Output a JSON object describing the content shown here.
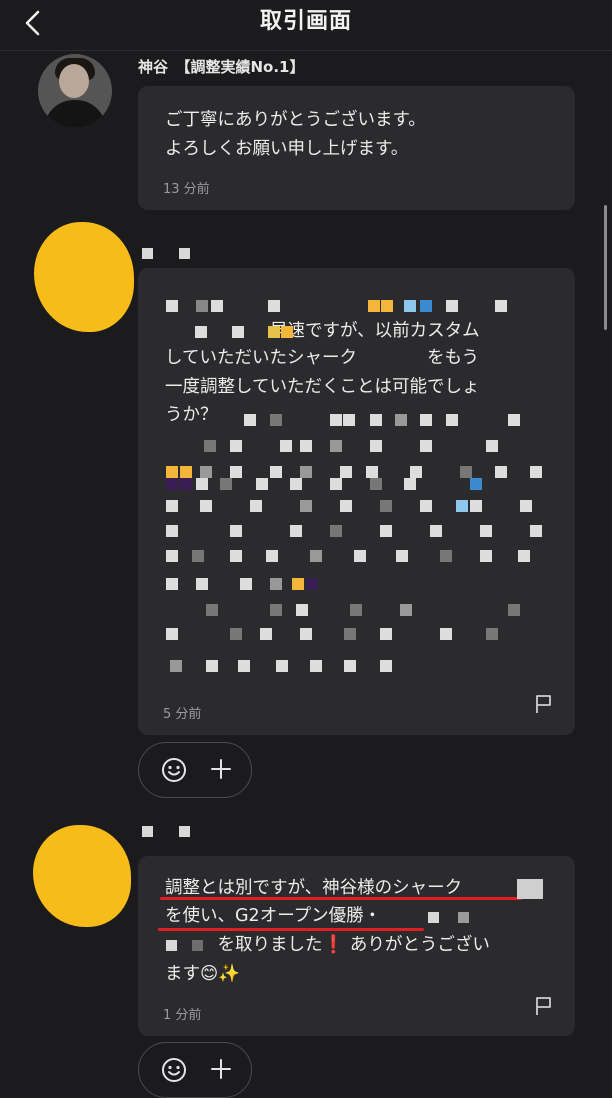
{
  "header": {
    "title": "取引画面",
    "back_icon": "chevron-left-icon"
  },
  "messages": [
    {
      "sender": "神谷　【調整実績No.1】",
      "lines": [
        "ご丁寧にありがとうございます。",
        "よろしくお願い申し上げます。"
      ],
      "time": "13 分前"
    },
    {
      "lines": [
        "　　　　　　早速ですが、以前カスタム",
        "していただいたシャーク　　　　をもう",
        "一度調整していただくことは可能でしょ",
        "うか？"
      ],
      "time": "5 分前"
    },
    {
      "lines": [
        "調整とは別ですが、神谷様のシャーク",
        "を使い、G2オープン優勝・",
        "　　　を取りました",
        "ます"
      ],
      "line3_tail": "ありがとうござい",
      "exclamation": "❗",
      "emoji": "😊",
      "sparkles": "✨",
      "time": "1 分前"
    }
  ],
  "colors": {
    "background": "#1b1b1d",
    "bubble": "#2b2b2e",
    "redact_blob": "#f7bb1a",
    "underline": "#e01e23"
  },
  "icons": [
    "chevron-left-icon",
    "flag-icon",
    "emoji-icon",
    "plus-icon"
  ]
}
